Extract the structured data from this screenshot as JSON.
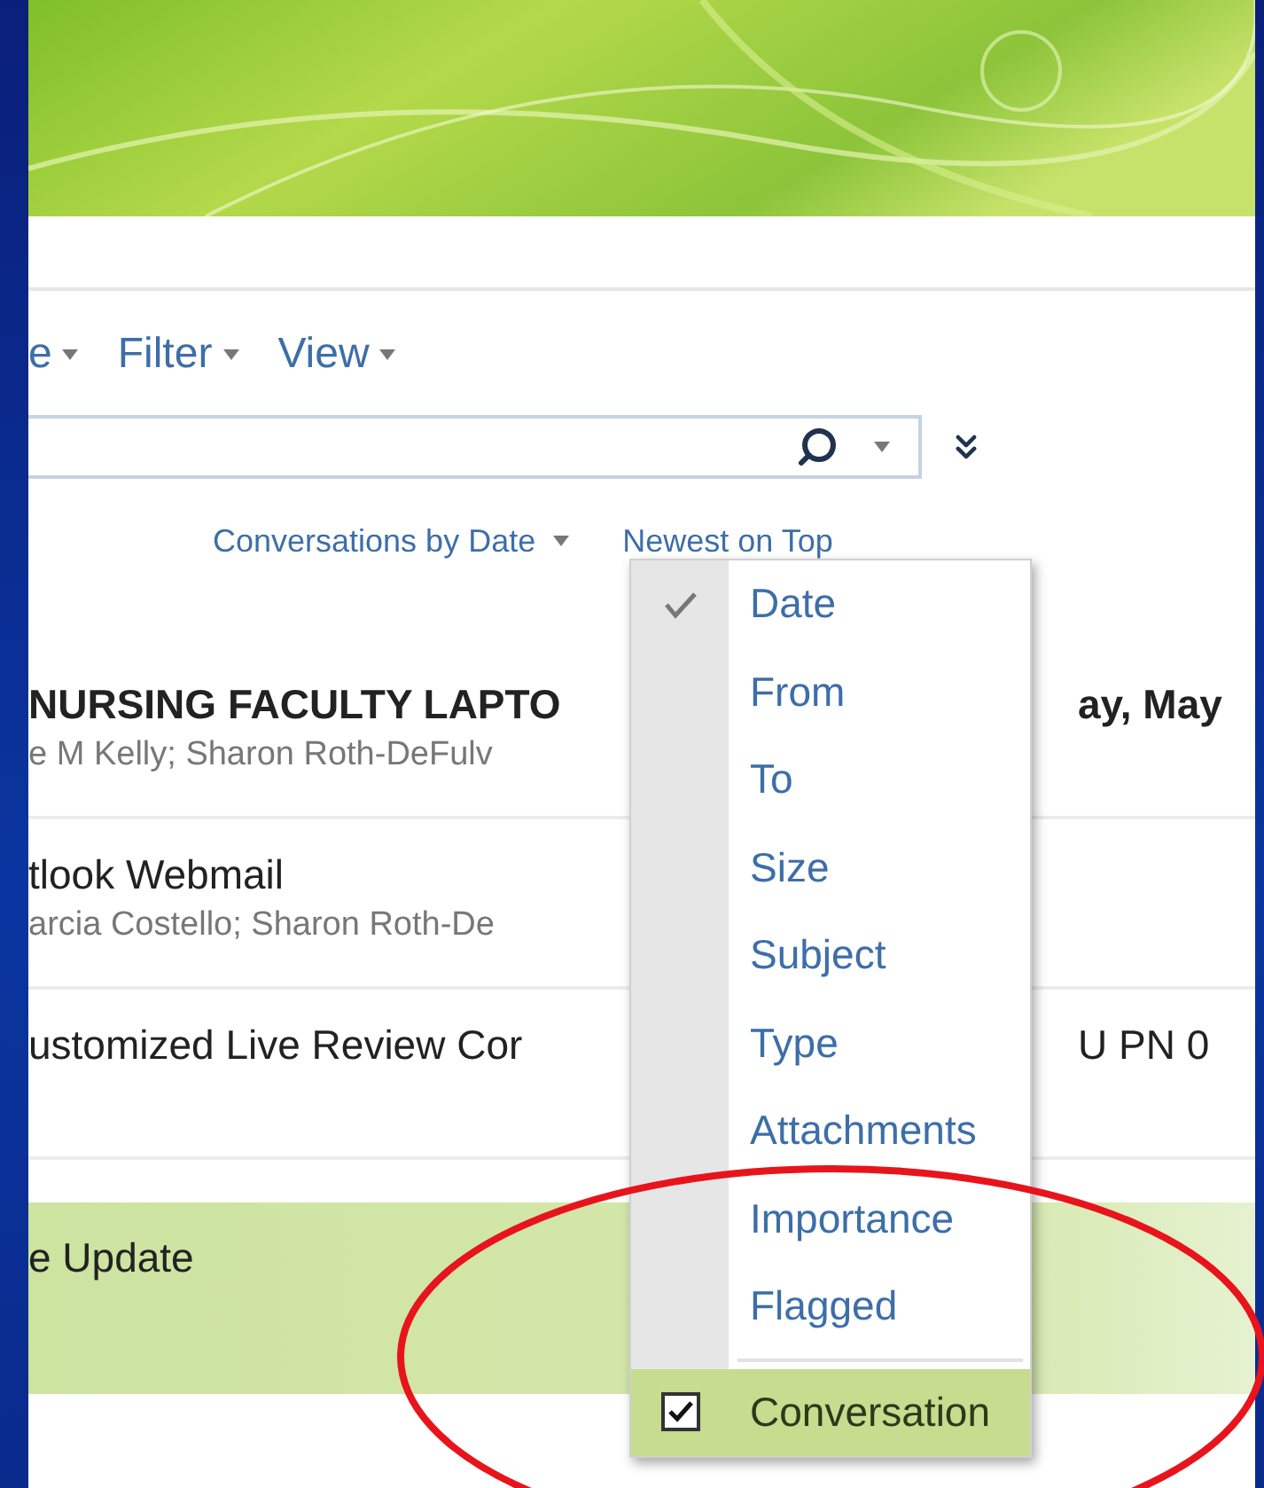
{
  "toolbar": [
    {
      "label": "e"
    },
    {
      "label": "Filter"
    },
    {
      "label": "View"
    }
  ],
  "sort": {
    "arrange": "Conversations by Date",
    "order": "Newest on Top"
  },
  "messages": [
    {
      "subject": "NURSING FACULTY LAPTO",
      "people": "e M Kelly; Sharon Roth-DeFulv",
      "date": "ay, May",
      "unread": true,
      "selected": false
    },
    {
      "subject": "tlook Webmail",
      "people": "arcia Costello; Sharon Roth-De",
      "unread": false,
      "selected": false
    },
    {
      "subject": "ustomized Live Review Cor",
      "date": "U PN 0",
      "unread": false,
      "selected": false
    },
    {
      "subject": "e Update",
      "unread": false,
      "selected": true
    }
  ],
  "menu": [
    {
      "kind": "option",
      "label": "Date",
      "checked": true,
      "selected": false
    },
    {
      "kind": "option",
      "label": "From",
      "checked": false,
      "selected": false
    },
    {
      "kind": "option",
      "label": "To",
      "checked": false,
      "selected": false
    },
    {
      "kind": "option",
      "label": "Size",
      "checked": false,
      "selected": false
    },
    {
      "kind": "option",
      "label": "Subject",
      "checked": false,
      "selected": false
    },
    {
      "kind": "option",
      "label": "Type",
      "checked": false,
      "selected": false
    },
    {
      "kind": "option",
      "label": "Attachments",
      "checked": false,
      "selected": false
    },
    {
      "kind": "option",
      "label": "Importance",
      "checked": false,
      "selected": false
    },
    {
      "kind": "option",
      "label": "Flagged",
      "checked": false,
      "selected": false
    },
    {
      "kind": "checkbox",
      "label": "Conversation",
      "checked": true,
      "selected": true
    }
  ]
}
